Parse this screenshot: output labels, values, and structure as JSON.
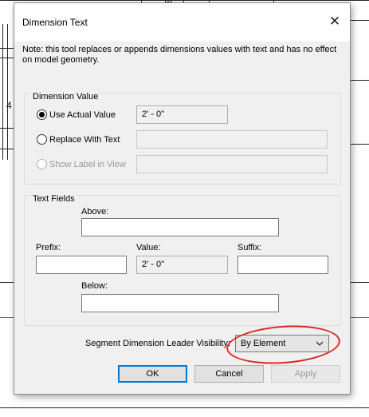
{
  "background": {
    "labels": [
      "CE",
      "4"
    ]
  },
  "dialog": {
    "title": "Dimension Text",
    "close_glyph": "✕",
    "note": "Note: this tool replaces or appends dimensions values with text and has no effect on model geometry."
  },
  "dimension_value": {
    "group_title": "Dimension Value",
    "use_actual_label": "Use Actual Value",
    "use_actual_value": "2' - 0\"",
    "replace_label": "Replace With Text",
    "replace_value": "",
    "show_label_label": "Show Label in View",
    "show_label_value": "",
    "selected": "use_actual"
  },
  "text_fields": {
    "group_title": "Text Fields",
    "above_label": "Above:",
    "above_value": "",
    "prefix_label": "Prefix:",
    "prefix_value": "",
    "value_label": "Value:",
    "value_value": "2' - 0\"",
    "suffix_label": "Suffix:",
    "suffix_value": "",
    "below_label": "Below:",
    "below_value": ""
  },
  "leader_visibility": {
    "label": "Segment Dimension Leader Visibility:",
    "selected": "By Element"
  },
  "buttons": {
    "ok": "OK",
    "cancel": "Cancel",
    "apply": "Apply"
  },
  "colors": {
    "annotation": "#e0251d",
    "default_button_border": "#0078d7"
  }
}
